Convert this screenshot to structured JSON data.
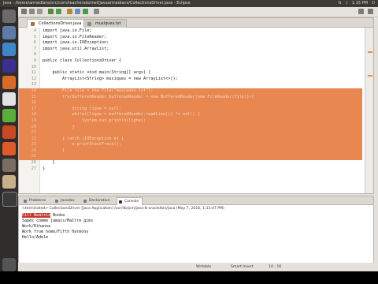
{
  "window": {
    "title": "Java - /home/armedians/src/com/teachersdotnet/javaarmedians/CollectionsDriver.java - Eclipse",
    "clock": "1:15 PM"
  },
  "tabs": [
    {
      "label": "CollectionsDriver.java"
    },
    {
      "label": "musiques.txt"
    }
  ],
  "code_lines": [
    {
      "n": "4",
      "text": "import java.io.File;"
    },
    {
      "n": "5",
      "text": "import java.io.FileReader;"
    },
    {
      "n": "6",
      "text": "import java.io.IOException;"
    },
    {
      "n": "7",
      "text": "import java.util.ArrayList;"
    },
    {
      "n": "8",
      "text": ""
    },
    {
      "n": "9",
      "text": "public class CollectionsDriver {"
    },
    {
      "n": "10",
      "text": ""
    },
    {
      "n": "11",
      "text": "    public static void main(String[] args) {"
    },
    {
      "n": "12",
      "text": "        ArrayList<String> musiques = new ArrayList<>();"
    },
    {
      "n": "13",
      "text": ""
    },
    {
      "n": "14",
      "text": "        File file = new File(\"musiques.txt\");"
    },
    {
      "n": "15",
      "text": "        try(BufferedReader bufferedReader = new BufferedReader(new FileReader(file))){"
    },
    {
      "n": "16",
      "text": ""
    },
    {
      "n": "17",
      "text": "            String ligne = null;"
    },
    {
      "n": "18",
      "text": "            while((ligne = bufferedReader.readLine()) != null) {"
    },
    {
      "n": "19",
      "text": "                System.out.println(ligne);"
    },
    {
      "n": "20",
      "text": "            }"
    },
    {
      "n": "21",
      "text": ""
    },
    {
      "n": "22",
      "text": "        } catch (IOException e) {"
    },
    {
      "n": "23",
      "text": "            e.printStackTrace();"
    },
    {
      "n": "24",
      "text": "        }"
    },
    {
      "n": "25",
      "text": ""
    },
    {
      "n": "26",
      "text": "    }"
    },
    {
      "n": "27",
      "text": "}"
    }
  ],
  "bottom_tabs": [
    {
      "label": "Problems"
    },
    {
      "label": "Javadoc"
    },
    {
      "label": "Declaration"
    },
    {
      "label": "Console"
    }
  ],
  "console": {
    "terminated": "<terminated> CollectionsDriver [Java Application] /usr/lib/jvm/java-8-oracle/bin/java (May 7, 2016, 1:13:47 PM)",
    "lines": [
      {
        "prefix": "Fill Beatrix",
        "rest": " Booba"
      },
      {
        "prefix": "",
        "rest": "Sapès comme jamais/Maître gims"
      },
      {
        "prefix": "",
        "rest": "Work/Rihanna"
      },
      {
        "prefix": "",
        "rest": "Work from home/Fifth Harmony"
      },
      {
        "prefix": "",
        "rest": "Hello/Adele"
      }
    ]
  },
  "status": {
    "mode": "Writable",
    "insert": "Smart Insert",
    "position": "14 : 16"
  },
  "colors": {
    "selection": "#e8874f",
    "launcher": "#2f2c2b",
    "topbar": "#3b3a36"
  }
}
